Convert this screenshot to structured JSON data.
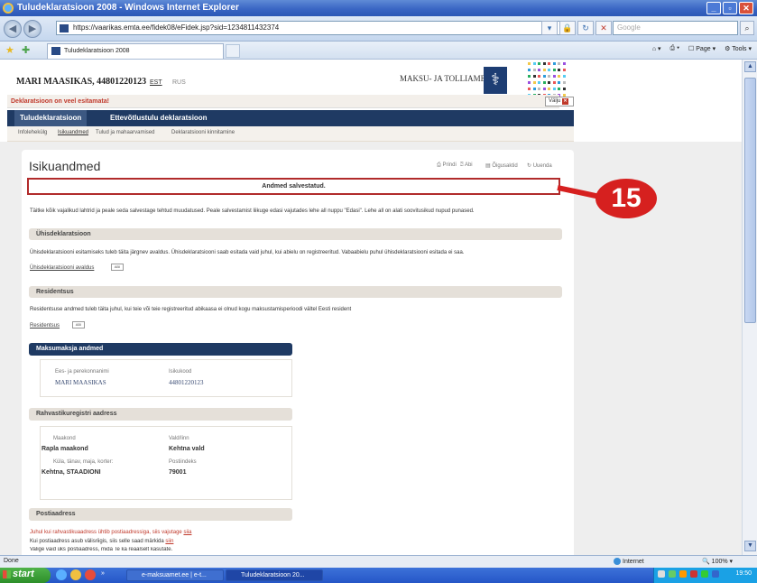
{
  "window": {
    "title": "Tuludeklaratsioon 2008 - Windows Internet Explorer"
  },
  "browser": {
    "url": "https://vaarikas.emta.ee/fidek08/eFidek.jsp?sid=1234811432374",
    "search_placeholder": "Google",
    "tab_title": "Tuludeklaratsioon 2008",
    "tools": {
      "page": "Page",
      "tools": "Tools"
    }
  },
  "header": {
    "person": "MARI MAASIKAS, 44801220123",
    "lang_est": "EST",
    "lang_rus": "RUS",
    "agency": "MAKSU- JA TOLLIAMET"
  },
  "warning": "Deklaratsioon on veel esitamata!",
  "exit_label": "Välju",
  "main_tabs": [
    "Tuludeklaratsioon",
    "Ettevõtlustulu deklaratsioon"
  ],
  "sub_nav": [
    "Infolehekülg",
    "Isikuandmed",
    "Tulud ja mahaarvamised",
    "Deklaratsiooni kinnitamine"
  ],
  "page": {
    "title": "Isikuandmed",
    "tools": [
      "Prindi",
      "Abi",
      "Õigusaktid",
      "Uuenda"
    ],
    "notice": "Andmed salvestatud.",
    "callout": "15",
    "instructions": "Täitke kõik vajalikud lahtrid ja peale seda salvestage tehtud muudatused. Peale salvestamist liikuge edasi vajutades lehe all nuppu \"Edasi\". Lehe all on alati soovitusikud nupud punased."
  },
  "joint": {
    "header": "Ühisdeklaratsioon",
    "text": "Ühisdeklaratsiooni esitamiseks tuleb täita järgnev avaldus. Ühisdeklaratsiooni saab esitada vaid juhul, kui abielu on registreeritud. Vabaabielu puhul ühisdeklaratsiooni esitada ei saa.",
    "link": "Ühisdeklaratsiooni avaldus",
    "chip": "ABI"
  },
  "residency": {
    "header": "Residentsus",
    "text": "Residentsuse andmed tuleb täita juhul, kui teie või teie registreeritud abikaasa ei olnud kogu maksustamisperioodi vältel Eesti resident",
    "link": "Residentsus",
    "chip": "ABI"
  },
  "taxpayer": {
    "header": "Maksumaksja andmed",
    "name_label": "Ees- ja perekonnanimi",
    "code_label": "Isikukood",
    "name": "MARI MAASIKAS",
    "code": "44801220123"
  },
  "address": {
    "header": "Rahvastikuregistri aadress",
    "county_label": "Maakond",
    "parish_label": "Vald/linn",
    "county": "Rapla maakond",
    "parish": "Kehtna vald",
    "street_label": "Küla, tänav, maja, korter:",
    "postal_label": "Postiindeks",
    "street": "Kehtna, STAADIONI",
    "postal": "79001"
  },
  "postal": {
    "header": "Postiaadress",
    "line1": "Juhul kui rahvastikuaadress ühtib postiaadressiga, siis vajutage",
    "line1_link": "siia",
    "line2": "Kui postiaadress asub välisriigis, siis selle saad märkida",
    "line2_link": "siin",
    "line3": "Valige vaid üks postiaadress, mida Te ka reaalselt kasutate."
  },
  "status": {
    "left": "Done",
    "zone": "Internet",
    "zoom": "100%"
  },
  "taskbar": {
    "start": "start",
    "more": "»",
    "tasks": [
      "e-maksuamet.ee | e-t...",
      "Tuludeklaratsioon 20..."
    ],
    "clock": "19:50"
  }
}
